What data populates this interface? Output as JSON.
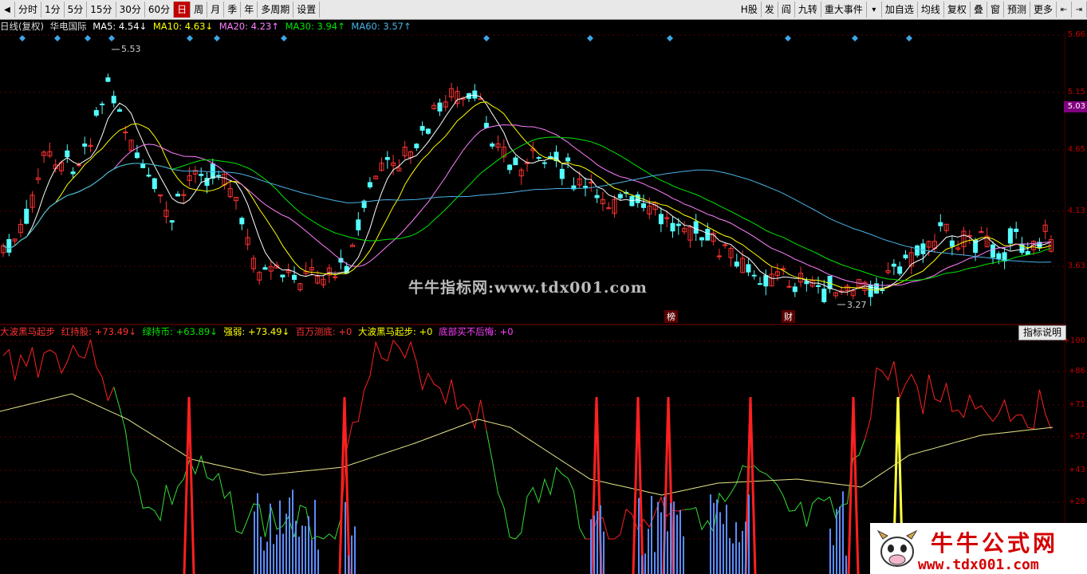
{
  "toolbar": {
    "periods": [
      "分时",
      "1分",
      "5分",
      "15分",
      "30分",
      "60分",
      "日",
      "周",
      "月",
      "季",
      "年",
      "多周期",
      "设置"
    ],
    "active_period": "日",
    "right_buttons": [
      "H股",
      "发",
      "阎",
      "九转",
      "重大事件",
      "加自选",
      "均线",
      "复权",
      "叠",
      "窗",
      "预测",
      "更多"
    ]
  },
  "info": {
    "label": "日线(复权)",
    "name": "华电国际",
    "ma5": "MA5: 4.54↓",
    "ma10": "MA10: 4.63↓",
    "ma20": "MA20: 4.23↑",
    "ma30": "MA30: 3.94↑",
    "ma60": "MA60: 3.57↑"
  },
  "price_axis": [
    "5.66",
    "5.15",
    "5.03",
    "4.65",
    "4.13",
    "3.63"
  ],
  "annotations": {
    "high": "5.53",
    "low": "3.27",
    "tag1": "榜",
    "tag2": "财"
  },
  "indicator": {
    "name": "大波黑马起步",
    "red": "红持股: +73.49↓",
    "green": "绿持币: +63.89↓",
    "strength": "强弱: +73.49↓",
    "million": "百万测底: +0",
    "start": "大波黑马起步: +0",
    "bottom": "底部买不后悔: +0",
    "button": "指标说明"
  },
  "ind_axis": [
    "100",
    "86",
    "71",
    "57",
    "43",
    "28"
  ],
  "watermark": "牛牛指标网:www.tdx001.com",
  "brand": {
    "title": "牛牛公式网",
    "url": "www.tdx001.com"
  },
  "colors": {
    "up": "#ff3232",
    "down": "#54ffff",
    "ma5": "#ffffff",
    "ma10": "#ffff00",
    "ma20": "#ff80ff",
    "ma30": "#00e600",
    "ma60": "#4ab3e6"
  }
}
